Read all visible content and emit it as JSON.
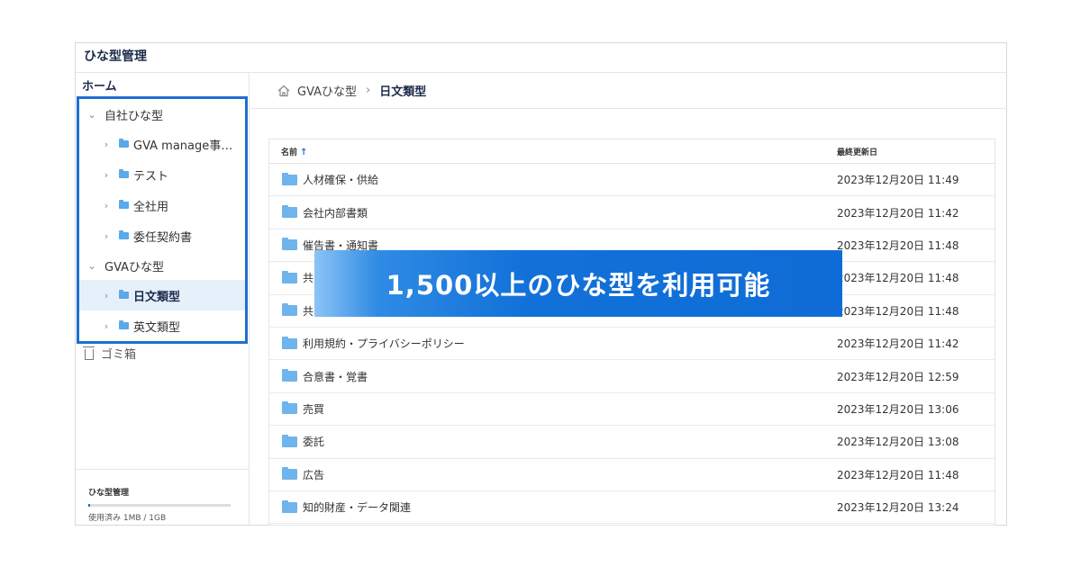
{
  "app": {
    "title": "ひな型管理"
  },
  "sidebar": {
    "home": "ホーム",
    "tree": [
      {
        "label": "自社ひな型",
        "level": 0,
        "expanded": true,
        "folder": false
      },
      {
        "label": "GVA manage事業部",
        "level": 1,
        "folder": true
      },
      {
        "label": "テスト",
        "level": 1,
        "folder": true
      },
      {
        "label": "全社用",
        "level": 1,
        "folder": true
      },
      {
        "label": "委任契約書",
        "level": 1,
        "folder": true
      },
      {
        "label": "GVAひな型",
        "level": 0,
        "expanded": true,
        "folder": false
      },
      {
        "label": "日文類型",
        "level": 1,
        "folder": true,
        "selected": true
      },
      {
        "label": "英文類型",
        "level": 1,
        "folder": true
      }
    ],
    "trash": "ゴミ箱",
    "storage": {
      "title": "ひな型管理",
      "usage": "使用済み 1MB / 1GB",
      "used_fraction": 0.001
    }
  },
  "breadcrumb": {
    "root": "GVAひな型",
    "current": "日文類型"
  },
  "table": {
    "columns": {
      "name": "名前",
      "updated": "最終更新日"
    },
    "rows": [
      {
        "name": "人材確保・供給",
        "updated": "2023年12月20日 11:49"
      },
      {
        "name": "会社内部書類",
        "updated": "2023年12月20日 11:42"
      },
      {
        "name": "催告書・通知書",
        "updated": "2023年12月20日 11:48"
      },
      {
        "name": "共同",
        "updated": "2023年12月20日 11:48"
      },
      {
        "name": "共同",
        "updated": "2023年12月20日 11:48"
      },
      {
        "name": "利用規約・プライバシーポリシー",
        "updated": "2023年12月20日 11:42"
      },
      {
        "name": "合意書・覚書",
        "updated": "2023年12月20日 12:59"
      },
      {
        "name": "売買",
        "updated": "2023年12月20日 13:06"
      },
      {
        "name": "委託",
        "updated": "2023年12月20日 13:08"
      },
      {
        "name": "広告",
        "updated": "2023年12月20日 11:48"
      },
      {
        "name": "知的財産・データ関連",
        "updated": "2023年12月20日 13:24"
      }
    ]
  },
  "banner": {
    "text": "1,500以上のひな型を利用可能"
  },
  "colors": {
    "accent": "#1d6fd1",
    "folder": "#6fb4ec",
    "banner": "#0f6cd6"
  }
}
